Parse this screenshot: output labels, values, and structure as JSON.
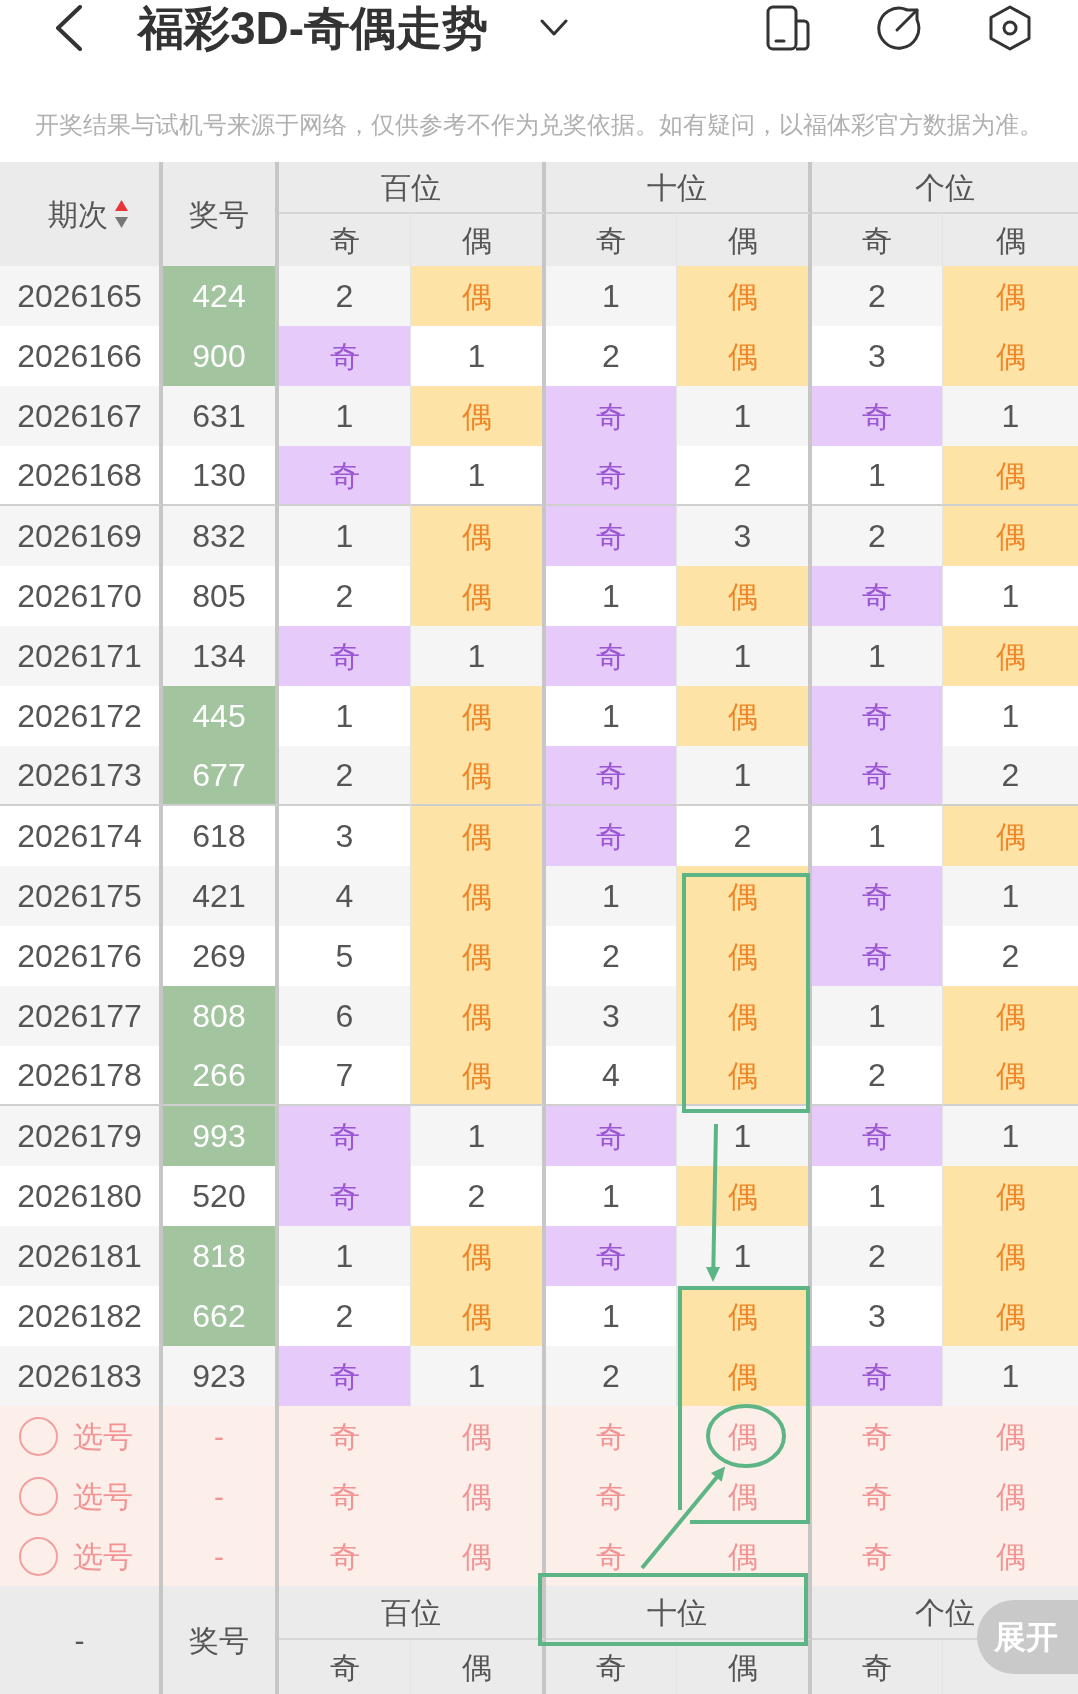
{
  "header": {
    "title": "福彩3D-奇偶走势"
  },
  "notice": "开奖结果与试机号来源于网络，仅供参考不作为兑奖依据。如有疑问，以福体彩官方数据为准。",
  "table": {
    "columns": {
      "issue": "期次",
      "number": "奖号",
      "positions": [
        {
          "label": "百位",
          "sub": [
            "奇",
            "偶"
          ]
        },
        {
          "label": "十位",
          "sub": [
            "奇",
            "偶"
          ]
        },
        {
          "label": "个位",
          "sub": [
            "奇",
            "偶"
          ]
        }
      ]
    },
    "sort_ascending": true,
    "groups": [
      {
        "rows": [
          {
            "issue": "2026165",
            "number": "424",
            "highlighted": true,
            "cells": [
              {
                "text": "2",
                "hit": false
              },
              {
                "text": "偶",
                "hit": true
              },
              {
                "text": "1",
                "hit": false
              },
              {
                "text": "偶",
                "hit": true
              },
              {
                "text": "2",
                "hit": false
              },
              {
                "text": "偶",
                "hit": true
              }
            ]
          },
          {
            "issue": "2026166",
            "number": "900",
            "highlighted": true,
            "cells": [
              {
                "text": "奇",
                "hit": true
              },
              {
                "text": "1",
                "hit": false
              },
              {
                "text": "2",
                "hit": false
              },
              {
                "text": "偶",
                "hit": true
              },
              {
                "text": "3",
                "hit": false
              },
              {
                "text": "偶",
                "hit": true
              }
            ]
          },
          {
            "issue": "2026167",
            "number": "631",
            "highlighted": false,
            "cells": [
              {
                "text": "1",
                "hit": false
              },
              {
                "text": "偶",
                "hit": true
              },
              {
                "text": "奇",
                "hit": true
              },
              {
                "text": "1",
                "hit": false
              },
              {
                "text": "奇",
                "hit": true
              },
              {
                "text": "1",
                "hit": false
              }
            ]
          },
          {
            "issue": "2026168",
            "number": "130",
            "highlighted": false,
            "cells": [
              {
                "text": "奇",
                "hit": true
              },
              {
                "text": "1",
                "hit": false
              },
              {
                "text": "奇",
                "hit": true
              },
              {
                "text": "2",
                "hit": false
              },
              {
                "text": "1",
                "hit": false
              },
              {
                "text": "偶",
                "hit": true
              }
            ]
          }
        ]
      },
      {
        "rows": [
          {
            "issue": "2026169",
            "number": "832",
            "highlighted": false,
            "cells": [
              {
                "text": "1",
                "hit": false
              },
              {
                "text": "偶",
                "hit": true
              },
              {
                "text": "奇",
                "hit": true
              },
              {
                "text": "3",
                "hit": false
              },
              {
                "text": "2",
                "hit": false
              },
              {
                "text": "偶",
                "hit": true
              }
            ]
          },
          {
            "issue": "2026170",
            "number": "805",
            "highlighted": false,
            "cells": [
              {
                "text": "2",
                "hit": false
              },
              {
                "text": "偶",
                "hit": true
              },
              {
                "text": "1",
                "hit": false
              },
              {
                "text": "偶",
                "hit": true
              },
              {
                "text": "奇",
                "hit": true
              },
              {
                "text": "1",
                "hit": false
              }
            ]
          },
          {
            "issue": "2026171",
            "number": "134",
            "highlighted": false,
            "cells": [
              {
                "text": "奇",
                "hit": true
              },
              {
                "text": "1",
                "hit": false
              },
              {
                "text": "奇",
                "hit": true
              },
              {
                "text": "1",
                "hit": false
              },
              {
                "text": "1",
                "hit": false
              },
              {
                "text": "偶",
                "hit": true
              }
            ]
          },
          {
            "issue": "2026172",
            "number": "445",
            "highlighted": true,
            "cells": [
              {
                "text": "1",
                "hit": false
              },
              {
                "text": "偶",
                "hit": true
              },
              {
                "text": "1",
                "hit": false
              },
              {
                "text": "偶",
                "hit": true
              },
              {
                "text": "奇",
                "hit": true
              },
              {
                "text": "1",
                "hit": false
              }
            ]
          },
          {
            "issue": "2026173",
            "number": "677",
            "highlighted": true,
            "cells": [
              {
                "text": "2",
                "hit": false
              },
              {
                "text": "偶",
                "hit": true
              },
              {
                "text": "奇",
                "hit": true
              },
              {
                "text": "1",
                "hit": false
              },
              {
                "text": "奇",
                "hit": true
              },
              {
                "text": "2",
                "hit": false
              }
            ]
          }
        ]
      },
      {
        "rows": [
          {
            "issue": "2026174",
            "number": "618",
            "highlighted": false,
            "cells": [
              {
                "text": "3",
                "hit": false
              },
              {
                "text": "偶",
                "hit": true
              },
              {
                "text": "奇",
                "hit": true
              },
              {
                "text": "2",
                "hit": false
              },
              {
                "text": "1",
                "hit": false
              },
              {
                "text": "偶",
                "hit": true
              }
            ]
          },
          {
            "issue": "2026175",
            "number": "421",
            "highlighted": false,
            "cells": [
              {
                "text": "4",
                "hit": false
              },
              {
                "text": "偶",
                "hit": true
              },
              {
                "text": "1",
                "hit": false
              },
              {
                "text": "偶",
                "hit": true
              },
              {
                "text": "奇",
                "hit": true
              },
              {
                "text": "1",
                "hit": false
              }
            ]
          },
          {
            "issue": "2026176",
            "number": "269",
            "highlighted": false,
            "cells": [
              {
                "text": "5",
                "hit": false
              },
              {
                "text": "偶",
                "hit": true
              },
              {
                "text": "2",
                "hit": false
              },
              {
                "text": "偶",
                "hit": true
              },
              {
                "text": "奇",
                "hit": true
              },
              {
                "text": "2",
                "hit": false
              }
            ]
          },
          {
            "issue": "2026177",
            "number": "808",
            "highlighted": true,
            "cells": [
              {
                "text": "6",
                "hit": false
              },
              {
                "text": "偶",
                "hit": true
              },
              {
                "text": "3",
                "hit": false
              },
              {
                "text": "偶",
                "hit": true
              },
              {
                "text": "1",
                "hit": false
              },
              {
                "text": "偶",
                "hit": true
              }
            ]
          },
          {
            "issue": "2026178",
            "number": "266",
            "highlighted": true,
            "cells": [
              {
                "text": "7",
                "hit": false
              },
              {
                "text": "偶",
                "hit": true
              },
              {
                "text": "4",
                "hit": false
              },
              {
                "text": "偶",
                "hit": true
              },
              {
                "text": "2",
                "hit": false
              },
              {
                "text": "偶",
                "hit": true
              }
            ]
          }
        ]
      },
      {
        "rows": [
          {
            "issue": "2026179",
            "number": "993",
            "highlighted": true,
            "cells": [
              {
                "text": "奇",
                "hit": true
              },
              {
                "text": "1",
                "hit": false
              },
              {
                "text": "奇",
                "hit": true
              },
              {
                "text": "1",
                "hit": false
              },
              {
                "text": "奇",
                "hit": true
              },
              {
                "text": "1",
                "hit": false
              }
            ]
          },
          {
            "issue": "2026180",
            "number": "520",
            "highlighted": false,
            "cells": [
              {
                "text": "奇",
                "hit": true
              },
              {
                "text": "2",
                "hit": false
              },
              {
                "text": "1",
                "hit": false
              },
              {
                "text": "偶",
                "hit": true
              },
              {
                "text": "1",
                "hit": false
              },
              {
                "text": "偶",
                "hit": true
              }
            ]
          },
          {
            "issue": "2026181",
            "number": "818",
            "highlighted": true,
            "cells": [
              {
                "text": "1",
                "hit": false
              },
              {
                "text": "偶",
                "hit": true
              },
              {
                "text": "奇",
                "hit": true
              },
              {
                "text": "1",
                "hit": false
              },
              {
                "text": "2",
                "hit": false
              },
              {
                "text": "偶",
                "hit": true
              }
            ]
          },
          {
            "issue": "2026182",
            "number": "662",
            "highlighted": true,
            "cells": [
              {
                "text": "2",
                "hit": false
              },
              {
                "text": "偶",
                "hit": true
              },
              {
                "text": "1",
                "hit": false
              },
              {
                "text": "偶",
                "hit": true
              },
              {
                "text": "3",
                "hit": false
              },
              {
                "text": "偶",
                "hit": true
              }
            ]
          },
          {
            "issue": "2026183",
            "number": "923",
            "highlighted": false,
            "cells": [
              {
                "text": "奇",
                "hit": true
              },
              {
                "text": "1",
                "hit": false
              },
              {
                "text": "2",
                "hit": false
              },
              {
                "text": "偶",
                "hit": true
              },
              {
                "text": "奇",
                "hit": true
              },
              {
                "text": "1",
                "hit": false
              }
            ]
          }
        ]
      }
    ],
    "pick_rows": [
      {
        "label": "选号",
        "checked": false,
        "number": "-",
        "options": [
          {
            "text": "奇",
            "selected": false
          },
          {
            "text": "偶",
            "selected": false
          },
          {
            "text": "奇",
            "selected": false
          },
          {
            "text": "偶",
            "selected": false
          },
          {
            "text": "奇",
            "selected": false
          },
          {
            "text": "偶",
            "selected": false
          }
        ]
      },
      {
        "label": "选号",
        "checked": false,
        "number": "-",
        "options": [
          {
            "text": "奇",
            "selected": false
          },
          {
            "text": "偶",
            "selected": false
          },
          {
            "text": "奇",
            "selected": false
          },
          {
            "text": "偶",
            "selected": false
          },
          {
            "text": "奇",
            "selected": false
          },
          {
            "text": "偶",
            "selected": false
          }
        ]
      },
      {
        "label": "选号",
        "checked": false,
        "number": "-",
        "options": [
          {
            "text": "奇",
            "selected": false
          },
          {
            "text": "偶",
            "selected": false
          },
          {
            "text": "奇",
            "selected": false
          },
          {
            "text": "偶",
            "selected": false
          },
          {
            "text": "奇",
            "selected": false
          },
          {
            "text": "偶",
            "selected": false
          }
        ]
      }
    ],
    "footer": {
      "issue": "-",
      "number": "奖号",
      "positions": [
        {
          "label": "百位",
          "sub": [
            "奇",
            "偶"
          ]
        },
        {
          "label": "十位",
          "sub": [
            "奇",
            "偶"
          ]
        },
        {
          "label": "个位",
          "sub": [
            "奇"
          ]
        }
      ]
    }
  },
  "expand_button": "展开"
}
